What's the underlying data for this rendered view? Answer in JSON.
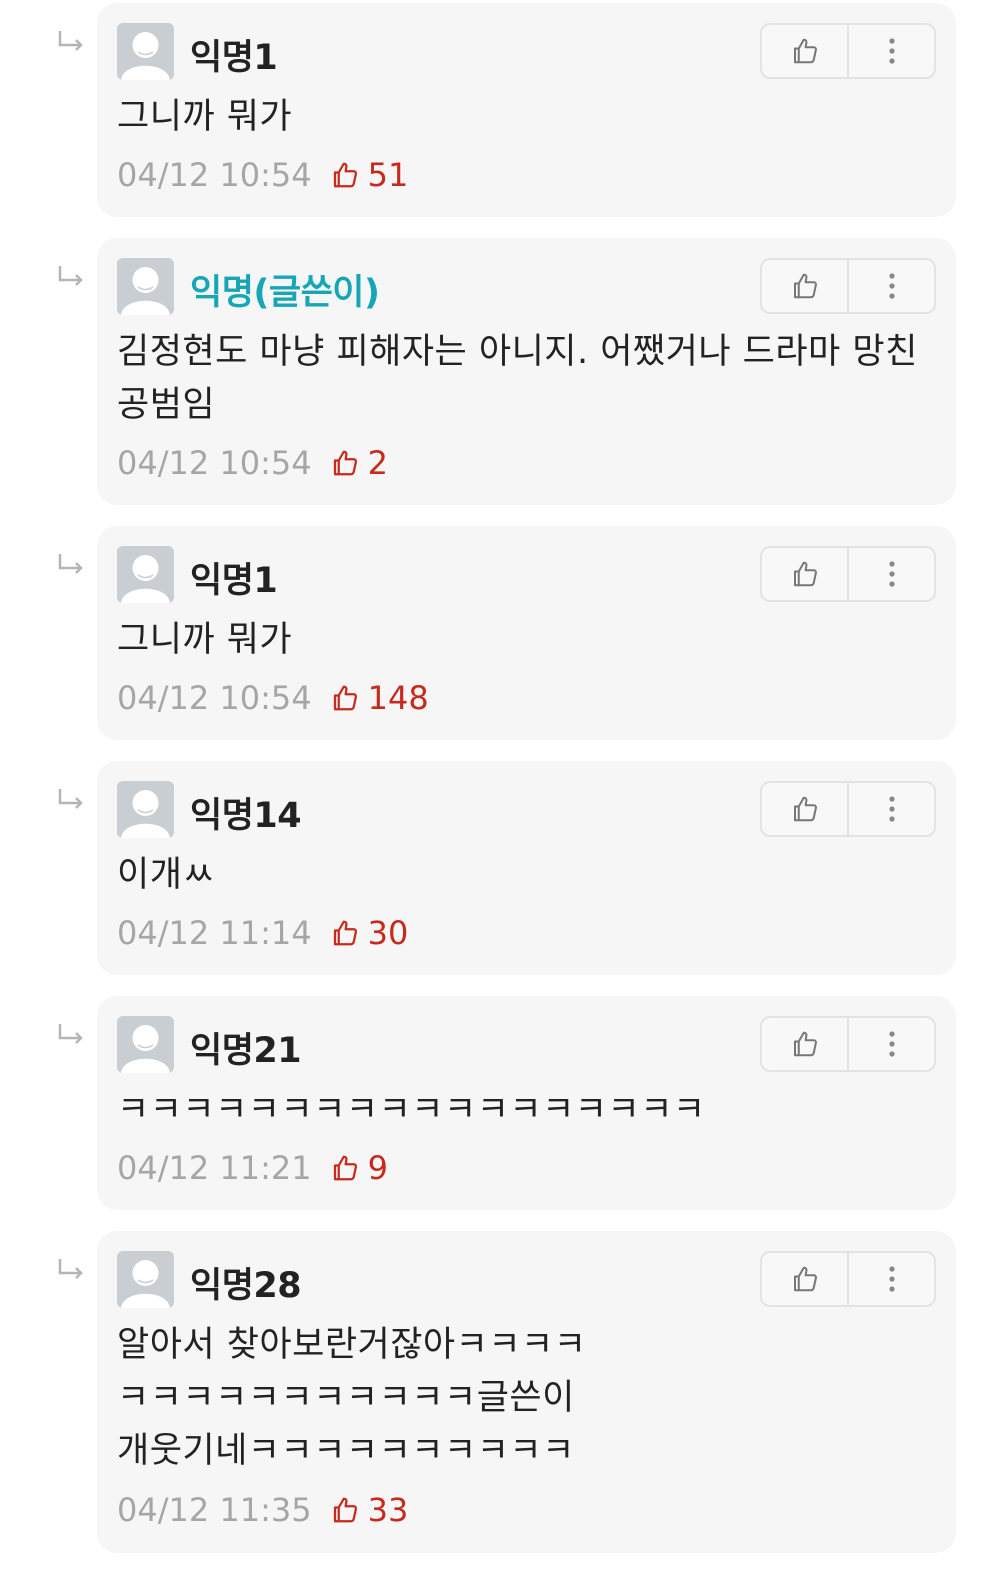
{
  "comments": [
    {
      "author": "익명1",
      "is_writer": false,
      "text": "그니까 뭐가",
      "time": "04/12 10:54",
      "votes": "51"
    },
    {
      "author": "익명(글쓴이)",
      "is_writer": true,
      "text": "김정현도 마냥 피해자는 아니지. 어쨌거나 드라마 망친\n공범임",
      "time": "04/12 10:54",
      "votes": "2"
    },
    {
      "author": "익명1",
      "is_writer": false,
      "text": "그니까 뭐가",
      "time": "04/12 10:54",
      "votes": "148"
    },
    {
      "author": "익명14",
      "is_writer": false,
      "text": "이개ㅆ",
      "time": "04/12 11:14",
      "votes": "30"
    },
    {
      "author": "익명21",
      "is_writer": false,
      "text": "ㅋㅋㅋㅋㅋㅋㅋㅋㅋㅋㅋㅋㅋㅋㅋㅋㅋㅋ",
      "time": "04/12 11:21",
      "votes": "9"
    },
    {
      "author": "익명28",
      "is_writer": false,
      "text": "알아서 찾아보란거잖아ㅋㅋㅋㅋ\nㅋㅋㅋㅋㅋㅋㅋㅋㅋㅋㅋ글쓴이\n개웃기네ㅋㅋㅋㅋㅋㅋㅋㅋㅋㅋ",
      "time": "04/12 11:35",
      "votes": "33"
    }
  ],
  "icons": {
    "reply": "reply-arrow-icon",
    "avatar": "default-avatar-icon",
    "like": "thumbs-up-icon",
    "more": "more-vertical-icon"
  },
  "colors": {
    "card_background": "#f6f6f6",
    "writer_name": "#16a6b6",
    "vote_red": "#c62a1c",
    "time_gray": "#a6a6a6"
  }
}
